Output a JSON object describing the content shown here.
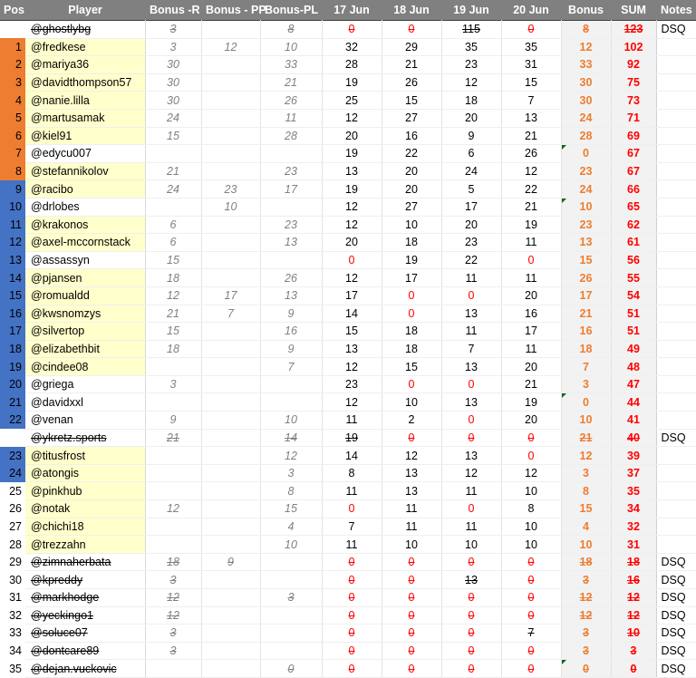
{
  "table": {
    "columns": [
      {
        "key": "pos",
        "label": "Pos"
      },
      {
        "key": "player",
        "label": "Player"
      },
      {
        "key": "bonus_r",
        "label": "Bonus -R"
      },
      {
        "key": "bonus_pp",
        "label": "Bonus - PP"
      },
      {
        "key": "bonus_pl",
        "label": "Bonus-PL"
      },
      {
        "key": "d17",
        "label": "17 Jun"
      },
      {
        "key": "d18",
        "label": "18 Jun"
      },
      {
        "key": "d19",
        "label": "19 Jun"
      },
      {
        "key": "d20",
        "label": "20 Jun"
      },
      {
        "key": "bonus",
        "label": "Bonus"
      },
      {
        "key": "sum",
        "label": "SUM"
      },
      {
        "key": "notes",
        "label": "Notes"
      }
    ],
    "colors": {
      "header_bg": "#808080",
      "header_text": "#ffffff",
      "pos_top_bg": "#ED7D31",
      "pos_mid_bg": "#4472C4",
      "player_highlight_bg": "#FFFFCC",
      "bonus_text": "#ED7D31",
      "sum_text": "#FF0000",
      "zero_text": "#FF0000",
      "bonus_col_text": "#808080",
      "comment_marker": "#0b6623"
    },
    "rows": [
      {
        "pos": "",
        "player": "@ghostlybg",
        "bonus_r": "3",
        "bonus_pp": "",
        "bonus_pl": "8",
        "d17": "0",
        "d18": "0",
        "d19": "115",
        "d20": "0",
        "bonus": "8",
        "sum": "123",
        "notes": "DSQ",
        "dsq": true,
        "pos_style": "plain",
        "highlight": false,
        "comment": false
      },
      {
        "pos": "1",
        "player": "@fredkese",
        "bonus_r": "3",
        "bonus_pp": "12",
        "bonus_pl": "10",
        "d17": "32",
        "d18": "29",
        "d19": "35",
        "d20": "35",
        "bonus": "12",
        "sum": "102",
        "notes": "",
        "dsq": false,
        "pos_style": "orange",
        "highlight": true,
        "comment": false
      },
      {
        "pos": "2",
        "player": "@mariya36",
        "bonus_r": "30",
        "bonus_pp": "",
        "bonus_pl": "33",
        "d17": "28",
        "d18": "21",
        "d19": "23",
        "d20": "31",
        "bonus": "33",
        "sum": "92",
        "notes": "",
        "dsq": false,
        "pos_style": "orange",
        "highlight": true,
        "comment": false
      },
      {
        "pos": "3",
        "player": "@davidthompson57",
        "bonus_r": "30",
        "bonus_pp": "",
        "bonus_pl": "21",
        "d17": "19",
        "d18": "26",
        "d19": "12",
        "d20": "15",
        "bonus": "30",
        "sum": "75",
        "notes": "",
        "dsq": false,
        "pos_style": "orange",
        "highlight": true,
        "comment": false
      },
      {
        "pos": "4",
        "player": "@nanie.lilla",
        "bonus_r": "30",
        "bonus_pp": "",
        "bonus_pl": "26",
        "d17": "25",
        "d18": "15",
        "d19": "18",
        "d20": "7",
        "bonus": "30",
        "sum": "73",
        "notes": "",
        "dsq": false,
        "pos_style": "orange",
        "highlight": true,
        "comment": false
      },
      {
        "pos": "5",
        "player": "@martusamak",
        "bonus_r": "24",
        "bonus_pp": "",
        "bonus_pl": "11",
        "d17": "12",
        "d18": "27",
        "d19": "20",
        "d20": "13",
        "bonus": "24",
        "sum": "71",
        "notes": "",
        "dsq": false,
        "pos_style": "orange",
        "highlight": true,
        "comment": false
      },
      {
        "pos": "6",
        "player": "@kiel91",
        "bonus_r": "15",
        "bonus_pp": "",
        "bonus_pl": "28",
        "d17": "20",
        "d18": "16",
        "d19": "9",
        "d20": "21",
        "bonus": "28",
        "sum": "69",
        "notes": "",
        "dsq": false,
        "pos_style": "orange",
        "highlight": true,
        "comment": false
      },
      {
        "pos": "7",
        "player": "@edycu007",
        "bonus_r": "",
        "bonus_pp": "",
        "bonus_pl": "",
        "d17": "19",
        "d18": "22",
        "d19": "6",
        "d20": "26",
        "bonus": "0",
        "sum": "67",
        "notes": "",
        "dsq": false,
        "pos_style": "orange",
        "highlight": false,
        "comment": true
      },
      {
        "pos": "8",
        "player": "@stefannikolov",
        "bonus_r": "21",
        "bonus_pp": "",
        "bonus_pl": "23",
        "d17": "13",
        "d18": "20",
        "d19": "24",
        "d20": "12",
        "bonus": "23",
        "sum": "67",
        "notes": "",
        "dsq": false,
        "pos_style": "orange",
        "highlight": true,
        "comment": false
      },
      {
        "pos": "9",
        "player": "@racibo",
        "bonus_r": "24",
        "bonus_pp": "23",
        "bonus_pl": "17",
        "d17": "19",
        "d18": "20",
        "d19": "5",
        "d20": "22",
        "bonus": "24",
        "sum": "66",
        "notes": "",
        "dsq": false,
        "pos_style": "blue",
        "highlight": true,
        "comment": false
      },
      {
        "pos": "10",
        "player": "@drlobes",
        "bonus_r": "",
        "bonus_pp": "10",
        "bonus_pl": "",
        "d17": "12",
        "d18": "27",
        "d19": "17",
        "d20": "21",
        "bonus": "10",
        "sum": "65",
        "notes": "",
        "dsq": false,
        "pos_style": "blue",
        "highlight": false,
        "comment": true
      },
      {
        "pos": "11",
        "player": "@krakonos",
        "bonus_r": "6",
        "bonus_pp": "",
        "bonus_pl": "23",
        "d17": "12",
        "d18": "10",
        "d19": "20",
        "d20": "19",
        "bonus": "23",
        "sum": "62",
        "notes": "",
        "dsq": false,
        "pos_style": "blue",
        "highlight": true,
        "comment": false
      },
      {
        "pos": "12",
        "player": "@axel-mccornstack",
        "bonus_r": "6",
        "bonus_pp": "",
        "bonus_pl": "13",
        "d17": "20",
        "d18": "18",
        "d19": "23",
        "d20": "11",
        "bonus": "13",
        "sum": "61",
        "notes": "",
        "dsq": false,
        "pos_style": "blue",
        "highlight": true,
        "comment": false
      },
      {
        "pos": "13",
        "player": "@assassyn",
        "bonus_r": "15",
        "bonus_pp": "",
        "bonus_pl": "",
        "d17": "0",
        "d18": "19",
        "d19": "22",
        "d20": "0",
        "bonus": "15",
        "sum": "56",
        "notes": "",
        "dsq": false,
        "pos_style": "blue",
        "highlight": false,
        "comment": false
      },
      {
        "pos": "14",
        "player": "@pjansen",
        "bonus_r": "18",
        "bonus_pp": "",
        "bonus_pl": "26",
        "d17": "12",
        "d18": "17",
        "d19": "11",
        "d20": "11",
        "bonus": "26",
        "sum": "55",
        "notes": "",
        "dsq": false,
        "pos_style": "blue",
        "highlight": true,
        "comment": false
      },
      {
        "pos": "15",
        "player": "@romualdd",
        "bonus_r": "12",
        "bonus_pp": "17",
        "bonus_pl": "13",
        "d17": "17",
        "d18": "0",
        "d19": "0",
        "d20": "20",
        "bonus": "17",
        "sum": "54",
        "notes": "",
        "dsq": false,
        "pos_style": "blue",
        "highlight": true,
        "comment": false
      },
      {
        "pos": "16",
        "player": "@kwsnomzys",
        "bonus_r": "21",
        "bonus_pp": "7",
        "bonus_pl": "9",
        "d17": "14",
        "d18": "0",
        "d19": "13",
        "d20": "16",
        "bonus": "21",
        "sum": "51",
        "notes": "",
        "dsq": false,
        "pos_style": "blue",
        "highlight": true,
        "comment": false
      },
      {
        "pos": "17",
        "player": "@silvertop",
        "bonus_r": "15",
        "bonus_pp": "",
        "bonus_pl": "16",
        "d17": "15",
        "d18": "18",
        "d19": "11",
        "d20": "17",
        "bonus": "16",
        "sum": "51",
        "notes": "",
        "dsq": false,
        "pos_style": "blue",
        "highlight": true,
        "comment": false
      },
      {
        "pos": "18",
        "player": "@elizabethbit",
        "bonus_r": "18",
        "bonus_pp": "",
        "bonus_pl": "9",
        "d17": "13",
        "d18": "18",
        "d19": "7",
        "d20": "11",
        "bonus": "18",
        "sum": "49",
        "notes": "",
        "dsq": false,
        "pos_style": "blue",
        "highlight": true,
        "comment": false
      },
      {
        "pos": "19",
        "player": "@cindee08",
        "bonus_r": "",
        "bonus_pp": "",
        "bonus_pl": "7",
        "d17": "12",
        "d18": "15",
        "d19": "13",
        "d20": "20",
        "bonus": "7",
        "sum": "48",
        "notes": "",
        "dsq": false,
        "pos_style": "blue",
        "highlight": true,
        "comment": false
      },
      {
        "pos": "20",
        "player": "@griega",
        "bonus_r": "3",
        "bonus_pp": "",
        "bonus_pl": "",
        "d17": "23",
        "d18": "0",
        "d19": "0",
        "d20": "21",
        "bonus": "3",
        "sum": "47",
        "notes": "",
        "dsq": false,
        "pos_style": "blue",
        "highlight": false,
        "comment": false
      },
      {
        "pos": "21",
        "player": "@davidxxl",
        "bonus_r": "",
        "bonus_pp": "",
        "bonus_pl": "",
        "d17": "12",
        "d18": "10",
        "d19": "13",
        "d20": "19",
        "bonus": "0",
        "sum": "44",
        "notes": "",
        "dsq": false,
        "pos_style": "blue",
        "highlight": false,
        "comment": true
      },
      {
        "pos": "22",
        "player": "@venan",
        "bonus_r": "9",
        "bonus_pp": "",
        "bonus_pl": "10",
        "d17": "11",
        "d18": "2",
        "d19": "0",
        "d20": "20",
        "bonus": "10",
        "sum": "41",
        "notes": "",
        "dsq": false,
        "pos_style": "blue",
        "highlight": false,
        "comment": false
      },
      {
        "pos": "",
        "player": "@ykretz.sports",
        "bonus_r": "21",
        "bonus_pp": "",
        "bonus_pl": "14",
        "d17": "19",
        "d18": "0",
        "d19": "0",
        "d20": "0",
        "bonus": "21",
        "sum": "40",
        "notes": "DSQ",
        "dsq": true,
        "pos_style": "plain",
        "highlight": false,
        "comment": false
      },
      {
        "pos": "23",
        "player": "@titusfrost",
        "bonus_r": "",
        "bonus_pp": "",
        "bonus_pl": "12",
        "d17": "14",
        "d18": "12",
        "d19": "13",
        "d20": "0",
        "bonus": "12",
        "sum": "39",
        "notes": "",
        "dsq": false,
        "pos_style": "blue",
        "highlight": true,
        "comment": false
      },
      {
        "pos": "24",
        "player": "@atongis",
        "bonus_r": "",
        "bonus_pp": "",
        "bonus_pl": "3",
        "d17": "8",
        "d18": "13",
        "d19": "12",
        "d20": "12",
        "bonus": "3",
        "sum": "37",
        "notes": "",
        "dsq": false,
        "pos_style": "blue",
        "highlight": true,
        "comment": false
      },
      {
        "pos": "25",
        "player": "@pinkhub",
        "bonus_r": "",
        "bonus_pp": "",
        "bonus_pl": "8",
        "d17": "11",
        "d18": "13",
        "d19": "11",
        "d20": "10",
        "bonus": "8",
        "sum": "35",
        "notes": "",
        "dsq": false,
        "pos_style": "plain",
        "highlight": true,
        "comment": false
      },
      {
        "pos": "26",
        "player": "@notak",
        "bonus_r": "12",
        "bonus_pp": "",
        "bonus_pl": "15",
        "d17": "0",
        "d18": "11",
        "d19": "0",
        "d20": "8",
        "bonus": "15",
        "sum": "34",
        "notes": "",
        "dsq": false,
        "pos_style": "plain",
        "highlight": true,
        "comment": false
      },
      {
        "pos": "27",
        "player": "@chichi18",
        "bonus_r": "",
        "bonus_pp": "",
        "bonus_pl": "4",
        "d17": "7",
        "d18": "11",
        "d19": "11",
        "d20": "10",
        "bonus": "4",
        "sum": "32",
        "notes": "",
        "dsq": false,
        "pos_style": "plain",
        "highlight": true,
        "comment": false
      },
      {
        "pos": "28",
        "player": "@trezzahn",
        "bonus_r": "",
        "bonus_pp": "",
        "bonus_pl": "10",
        "d17": "11",
        "d18": "10",
        "d19": "10",
        "d20": "10",
        "bonus": "10",
        "sum": "31",
        "notes": "",
        "dsq": false,
        "pos_style": "plain",
        "highlight": true,
        "comment": false
      },
      {
        "pos": "29",
        "player": "@zimnaherbata",
        "bonus_r": "18",
        "bonus_pp": "9",
        "bonus_pl": "",
        "d17": "0",
        "d18": "0",
        "d19": "0",
        "d20": "0",
        "bonus": "18",
        "sum": "18",
        "notes": "DSQ",
        "dsq": true,
        "pos_style": "plain",
        "highlight": false,
        "comment": false
      },
      {
        "pos": "30",
        "player": "@kpreddy",
        "bonus_r": "3",
        "bonus_pp": "",
        "bonus_pl": "",
        "d17": "0",
        "d18": "0",
        "d19": "13",
        "d20": "0",
        "bonus": "3",
        "sum": "16",
        "notes": "DSQ",
        "dsq": true,
        "pos_style": "plain",
        "highlight": false,
        "comment": false
      },
      {
        "pos": "31",
        "player": "@markhodge",
        "bonus_r": "12",
        "bonus_pp": "",
        "bonus_pl": "3",
        "d17": "0",
        "d18": "0",
        "d19": "0",
        "d20": "0",
        "bonus": "12",
        "sum": "12",
        "notes": "DSQ",
        "dsq": true,
        "pos_style": "plain",
        "highlight": false,
        "comment": false
      },
      {
        "pos": "32",
        "player": "@yeckingo1",
        "bonus_r": "12",
        "bonus_pp": "",
        "bonus_pl": "",
        "d17": "0",
        "d18": "0",
        "d19": "0",
        "d20": "0",
        "bonus": "12",
        "sum": "12",
        "notes": "DSQ",
        "dsq": true,
        "pos_style": "plain",
        "highlight": false,
        "comment": false
      },
      {
        "pos": "33",
        "player": "@soluce07",
        "bonus_r": "3",
        "bonus_pp": "",
        "bonus_pl": "",
        "d17": "0",
        "d18": "0",
        "d19": "0",
        "d20": "7",
        "bonus": "3",
        "sum": "10",
        "notes": "DSQ",
        "dsq": true,
        "pos_style": "plain",
        "highlight": false,
        "comment": false
      },
      {
        "pos": "34",
        "player": "@dontcare89",
        "bonus_r": "3",
        "bonus_pp": "",
        "bonus_pl": "",
        "d17": "0",
        "d18": "0",
        "d19": "0",
        "d20": "0",
        "bonus": "3",
        "sum": "3",
        "notes": "DSQ",
        "dsq": true,
        "pos_style": "plain",
        "highlight": false,
        "comment": false
      },
      {
        "pos": "35",
        "player": "@dejan.vuckovic",
        "bonus_r": "",
        "bonus_pp": "",
        "bonus_pl": "0",
        "d17": "0",
        "d18": "0",
        "d19": "0",
        "d20": "0",
        "bonus": "0",
        "sum": "0",
        "notes": "DSQ",
        "dsq": true,
        "pos_style": "plain",
        "highlight": false,
        "comment": true
      }
    ]
  }
}
